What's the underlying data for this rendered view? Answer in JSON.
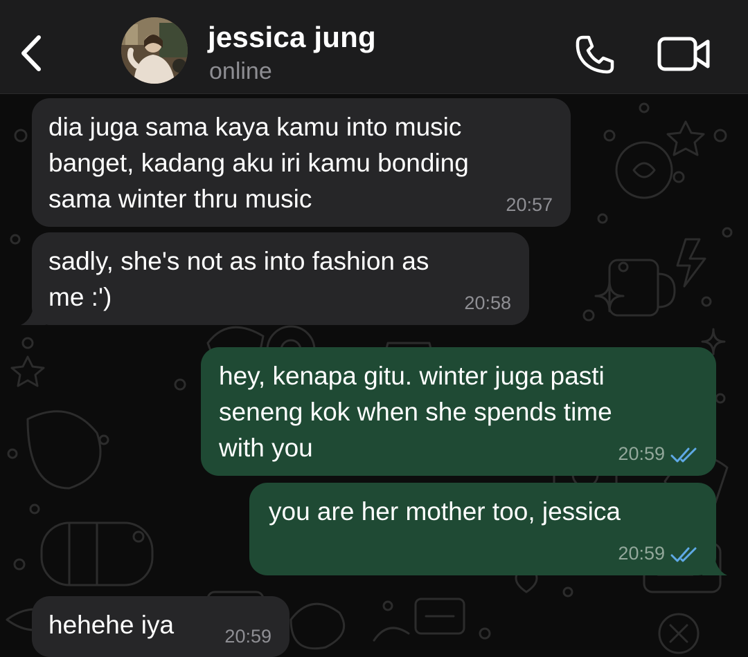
{
  "header": {
    "contact_name": "jessica jung",
    "status": "online",
    "icons": {
      "back": "chevron-left-icon",
      "call": "phone-icon",
      "video": "video-camera-icon"
    }
  },
  "colors": {
    "header_bg": "#1c1c1d",
    "incoming_bubble": "#262628",
    "outgoing_bubble": "#1f4a34",
    "read_ticks": "#5fa9e6",
    "timestamp": "#8f8f94"
  },
  "messages": [
    {
      "direction": "incoming",
      "text": "dia juga sama kaya kamu into music\nbanget, kadang aku iri kamu bonding\nsama winter thru music",
      "time": "20:57"
    },
    {
      "direction": "incoming",
      "text": "sadly, she's not as into fashion as\nme :')",
      "time": "20:58"
    },
    {
      "direction": "outgoing",
      "text": "hey, kenapa gitu. winter juga pasti\nseneng kok when she spends time\nwith you",
      "time": "20:59",
      "status": "read"
    },
    {
      "direction": "outgoing",
      "text": "you are her mother too, jessica",
      "time": "20:59",
      "status": "read"
    },
    {
      "direction": "incoming",
      "text": "hehehe iya",
      "time": "20:59"
    }
  ]
}
